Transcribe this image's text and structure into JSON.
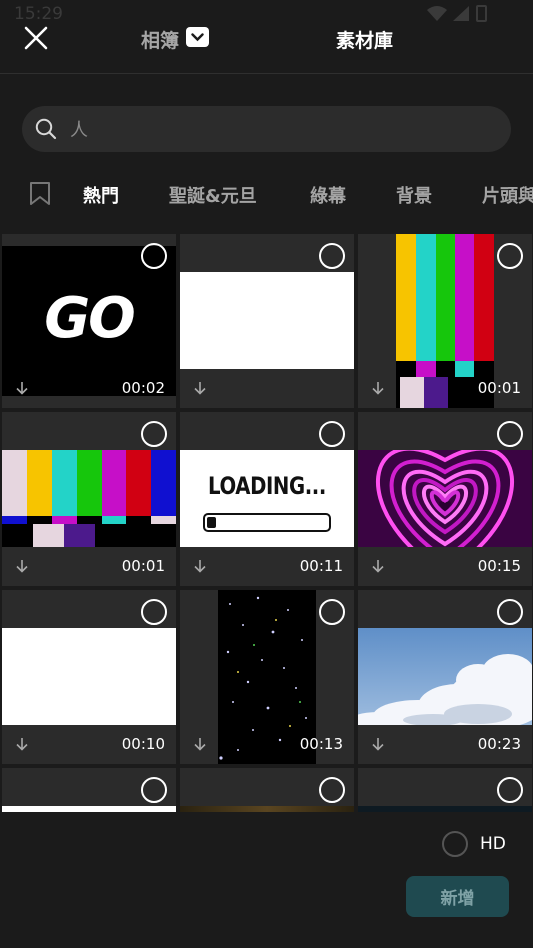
{
  "status_bar": {
    "time": "15:29"
  },
  "header": {
    "album_label": "相簿",
    "library_label": "素材庫"
  },
  "search": {
    "placeholder": "人"
  },
  "categories": [
    "熱門",
    "聖誕&元旦",
    "綠幕",
    "背景",
    "片頭與"
  ],
  "tiles": [
    {
      "duration": "00:02",
      "content": "GO"
    },
    {
      "duration": "",
      "content": ""
    },
    {
      "duration": "00:01",
      "content": ""
    },
    {
      "duration": "00:01",
      "content": ""
    },
    {
      "duration": "00:11",
      "content": "LOADING..."
    },
    {
      "duration": "00:15",
      "content": ""
    },
    {
      "duration": "00:10",
      "content": ""
    },
    {
      "duration": "00:13",
      "content": ""
    },
    {
      "duration": "00:23",
      "content": ""
    },
    {
      "duration": "",
      "content": ""
    },
    {
      "duration": "",
      "content": ""
    },
    {
      "duration": "",
      "content": ""
    }
  ],
  "footer": {
    "hd_label": "HD",
    "add_label": "新增"
  },
  "colors": {
    "accent": "#1f4a50",
    "background": "#1b1b1b",
    "tile": "#2b2b2b"
  }
}
